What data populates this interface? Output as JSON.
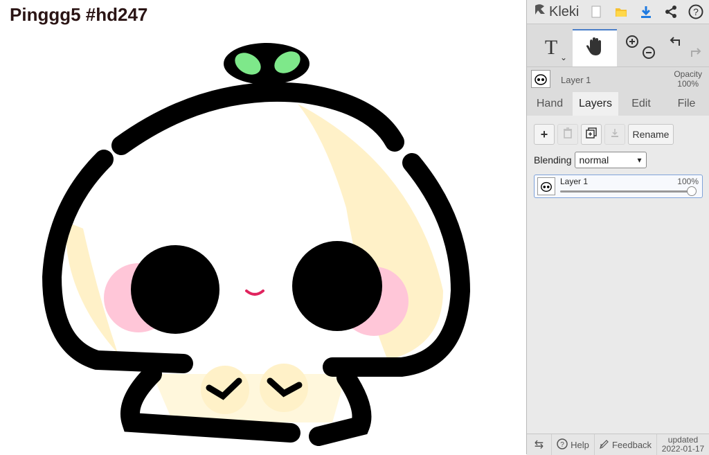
{
  "canvas": {
    "title": "Pinggg5 #hd247"
  },
  "app": {
    "name": "Kleki"
  },
  "topbar": {
    "icons": [
      "new-image-icon",
      "open-folder-icon",
      "download-icon",
      "share-icon",
      "help-icon"
    ]
  },
  "tools": {
    "text_label": "T",
    "items": [
      "text-tool-icon",
      "hand-tool-icon",
      "zoom-in-icon",
      "zoom-out-icon",
      "undo-icon",
      "redo-icon"
    ]
  },
  "layer_info": {
    "name": "Layer 1",
    "opacity_label": "Opacity",
    "opacity_value": "100%"
  },
  "tabs": [
    {
      "label": "Hand"
    },
    {
      "label": "Layers",
      "active": true
    },
    {
      "label": "Edit"
    },
    {
      "label": "File"
    }
  ],
  "layers_panel": {
    "rename_label": "Rename",
    "blending_label": "Blending",
    "blending_value": "normal",
    "layers": [
      {
        "name": "Layer 1",
        "opacity": "100%"
      }
    ]
  },
  "bottombar": {
    "help_label": "Help",
    "feedback_label": "Feedback",
    "updated_label": "updated",
    "updated_date": "2022-01-17"
  },
  "colors": {
    "accent": "#4a7ec9",
    "blush": "#ffc6d8",
    "cream": "#fff1c8",
    "leaf": "#7ee88a",
    "mouth": "#e0245e"
  }
}
